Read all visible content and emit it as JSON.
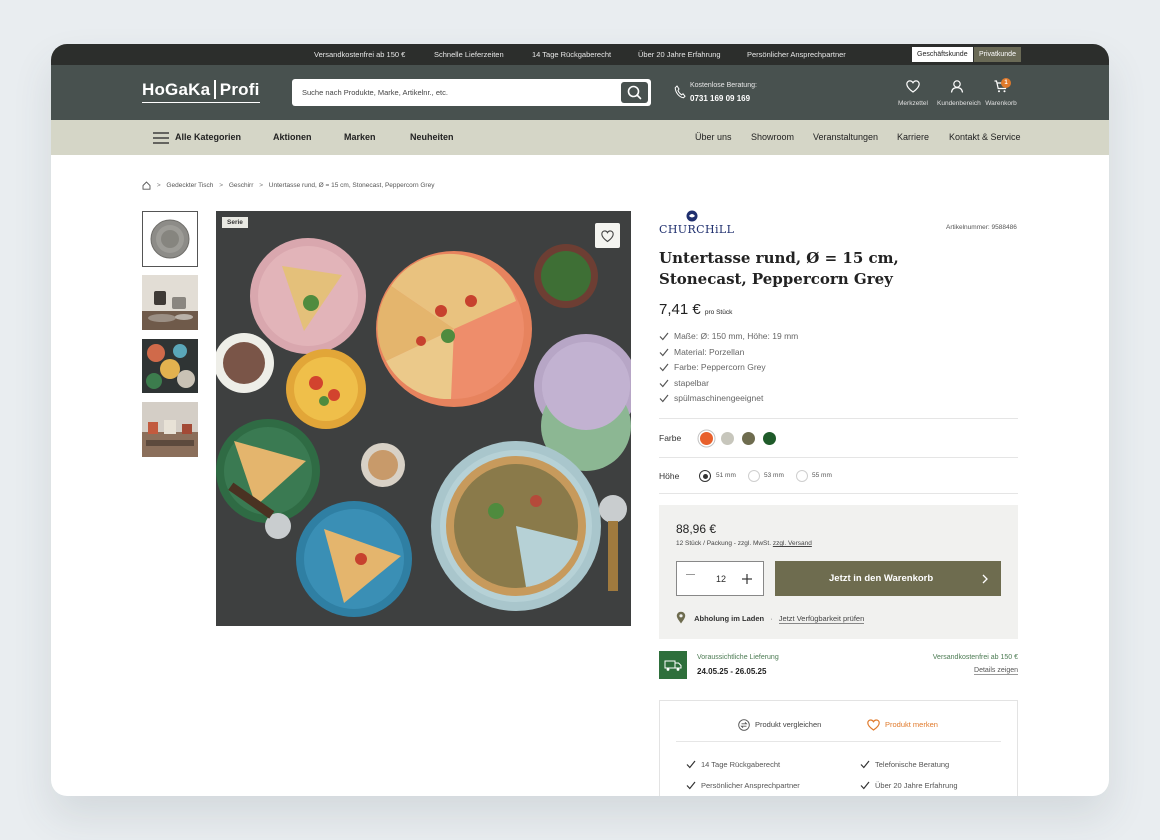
{
  "topbar": {
    "usps": [
      "Versandkostenfrei ab 150 €",
      "Schnelle Lieferzeiten",
      "14 Tage Rückgaberecht",
      "Über 20 Jahre Erfahrung",
      "Persönlicher Ansprechpartner"
    ],
    "segments": [
      "Geschäftskunde",
      "Privatkunde"
    ]
  },
  "header": {
    "logo_left": "HoGaKa",
    "logo_right": "Profi",
    "search_placeholder": "Suche nach Produkte, Marke, Artikelnr., etc.",
    "contact_label": "Kostenlose Beratung:",
    "contact_phone": "0731 169 09 169",
    "icons": [
      {
        "label": "Merkzettel",
        "icon": "heart-icon"
      },
      {
        "label": "Kundenbereich",
        "icon": "user-icon"
      },
      {
        "label": "Warenkorb",
        "icon": "cart-icon",
        "badge": "1"
      }
    ]
  },
  "nav": {
    "left": [
      "Alle Kategorien",
      "Aktionen",
      "Marken",
      "Neuheiten"
    ],
    "right": [
      "Über uns",
      "Showroom",
      "Veranstaltungen",
      "Karriere",
      "Kontakt & Service"
    ]
  },
  "breadcrumb": [
    "Gedeckter Tisch",
    "Geschirr",
    "Untertasse rund, Ø = 15 cm, Stonecast, Peppercorn Grey"
  ],
  "gallery": {
    "badge": "Serie"
  },
  "product": {
    "brand": "CHURCHiLL",
    "article_number": "Artikelnummer: 9588486",
    "title": "Untertasse rund, Ø = 15 cm, Stonecast, Peppercorn Grey",
    "price": "7,41 €",
    "price_unit": "pro Stück",
    "features": [
      "Maße: Ø: 150 mm, Höhe: 19 mm",
      "Material: Porzellan",
      "Farbe: Peppercorn Grey",
      "stapelbar",
      "spülmaschinengeeignet"
    ],
    "color_label": "Farbe",
    "colors": [
      "#e8602c",
      "#c7c6bc",
      "#6e6c4f",
      "#1f5b2a"
    ],
    "height_label": "Höhe",
    "heights": [
      "51 mm",
      "53 mm",
      "55 mm"
    ]
  },
  "buybox": {
    "pack_price": "88,96 €",
    "pack_info": "12 Stück / Packung - zzgl. MwSt.",
    "shipping_link": "zzgl. Versand",
    "quantity": "12",
    "cart_button": "Jetzt in den Warenkorb",
    "pickup_label": "Abholung im Laden",
    "pickup_link": "Jetzt Verfügbarkeit prüfen"
  },
  "delivery": {
    "label": "Voraussichtliche Lieferung",
    "dates": "24.05.25 - 26.05.25",
    "free_shipping": "Versandkostenfrei ab 150 €",
    "details_link": "Details zeigen"
  },
  "actions": {
    "compare": "Produkt vergleichen",
    "remember": "Produkt merken"
  },
  "usps_box": [
    "14 Tage Rückgaberecht",
    "Telefonische Beratung",
    "Persönlicher Ansprechpartner",
    "Über 20 Jahre Erfahrung"
  ],
  "colors": {
    "header_bg": "#48514f",
    "nav_bg": "#d5d6c7",
    "cta": "#6e6c4f",
    "accent_orange": "#e07a2c",
    "delivery_green": "#2e6f3b"
  }
}
